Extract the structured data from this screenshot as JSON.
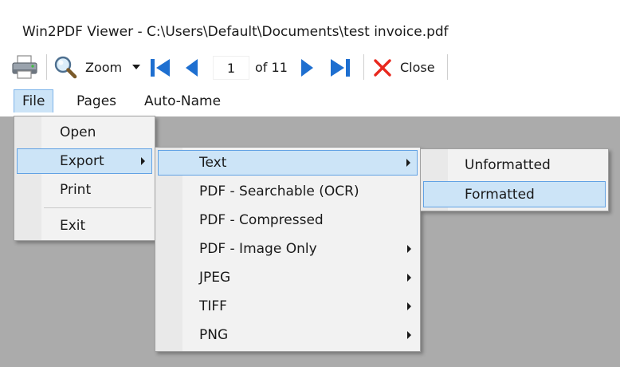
{
  "window": {
    "title": "Win2PDF Viewer - C:\\Users\\Default\\Documents\\test invoice.pdf"
  },
  "toolbar": {
    "print_icon": "printer-icon",
    "zoom_label": "Zoom",
    "page_value": "1",
    "page_of": "of 11",
    "close_label": "Close"
  },
  "menubar": {
    "file": "File",
    "pages": "Pages",
    "auto_name": "Auto-Name"
  },
  "file_menu": {
    "open": "Open",
    "export": "Export",
    "print": "Print",
    "exit": "Exit"
  },
  "export_menu": {
    "text": "Text",
    "pdf_searchable": "PDF - Searchable (OCR)",
    "pdf_compressed": "PDF - Compressed",
    "pdf_image_only": "PDF - Image Only",
    "jpeg": "JPEG",
    "tiff": "TIFF",
    "png": "PNG"
  },
  "text_menu": {
    "unformatted": "Unformatted",
    "formatted": "Formatted"
  },
  "colors": {
    "highlight": "#cce4f7",
    "highlight_border": "#62a2e4",
    "nav_blue": "#1e6fd0",
    "close_red": "#e8281e",
    "workspace": "#ababab"
  }
}
